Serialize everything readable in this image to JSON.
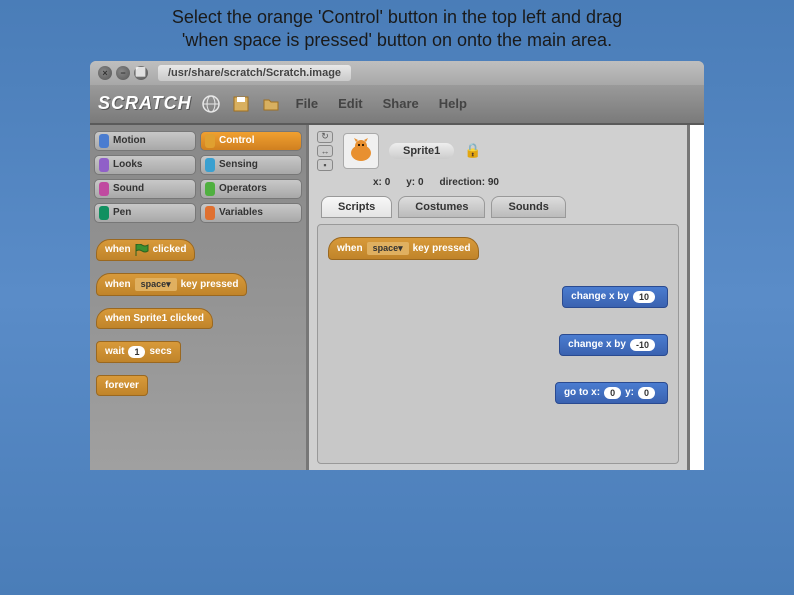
{
  "instruction": {
    "line1": "Select the orange 'Control' button in the top left and drag",
    "line2": "'when space is pressed' button on onto the main area."
  },
  "window": {
    "path": "/usr/share/scratch/Scratch.image",
    "logo": "SCRATCH",
    "menu": {
      "file": "File",
      "edit": "Edit",
      "share": "Share",
      "help": "Help"
    }
  },
  "categories": {
    "motion": "Motion",
    "control": "Control",
    "looks": "Looks",
    "sensing": "Sensing",
    "sound": "Sound",
    "operators": "Operators",
    "pen": "Pen",
    "variables": "Variables"
  },
  "colors": {
    "motion": "#4a7cd0",
    "control": "#e0a030",
    "looks": "#9060c8",
    "sensing": "#3aa0d0",
    "sound": "#c04aa0",
    "operators": "#50b040",
    "pen": "#109060",
    "variables": "#e07030"
  },
  "palette": {
    "when_flag": {
      "when": "when",
      "clicked": "clicked"
    },
    "when_key": {
      "when": "when",
      "key": "space",
      "pressed": "key pressed"
    },
    "when_sprite": "when Sprite1 clicked",
    "wait": {
      "wait": "wait",
      "n": "1",
      "secs": "secs"
    },
    "forever": "forever"
  },
  "sprite": {
    "name": "Sprite1",
    "x_label": "x:",
    "x_val": "0",
    "y_label": "y:",
    "y_val": "0",
    "dir_label": "direction:",
    "dir_val": "90"
  },
  "tabs": {
    "scripts": "Scripts",
    "costumes": "Costumes",
    "sounds": "Sounds"
  },
  "scripts": {
    "hat": {
      "when": "when",
      "key": "space",
      "pressed": "key pressed"
    },
    "chg1": {
      "label": "change x by",
      "val": "10"
    },
    "chg2": {
      "label": "change x by",
      "val": "-10"
    },
    "goto": {
      "label": "go to x:",
      "x": "0",
      "ylabel": "y:",
      "y": "0"
    }
  }
}
